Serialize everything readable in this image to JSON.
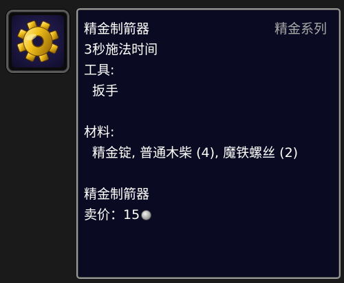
{
  "item_icon": {
    "icon": "gold-gear-icon",
    "colors": {
      "gear": "#f2c21b",
      "background": "#1a1640"
    }
  },
  "tooltip": {
    "title": "精金制箭器",
    "profession": "精金系列",
    "cast_time": "3秒施法时间",
    "tools_label": "工具:",
    "tool": "扳手",
    "materials_label": "材料:",
    "materials": "精金锭, 普通木柴 (4), 魔铁螺丝 (2)",
    "result_name": "精金制箭器",
    "sell_label": "卖价：",
    "sell_value": "15",
    "sell_currency_icon": "silver-coin-icon"
  }
}
